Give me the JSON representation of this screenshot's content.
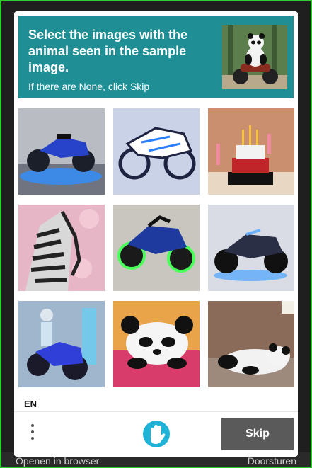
{
  "challenge": {
    "title": "Select the images with the animal seen in the sample image.",
    "subtitle": "If there are None, click Skip",
    "sample_image": "panda-riding-motorcycle"
  },
  "tiles": [
    {
      "content": "blue-motorcycle-showroom"
    },
    {
      "content": "wireframe-motorcycle"
    },
    {
      "content": "birthday-cake-candles"
    },
    {
      "content": "zebra-with-flowers"
    },
    {
      "content": "green-motorcycle"
    },
    {
      "content": "neon-motorcycle"
    },
    {
      "content": "robot-rider-motorcycle"
    },
    {
      "content": "panda-sleeping-cushion"
    },
    {
      "content": "panda-lying-floor"
    }
  ],
  "footer": {
    "language": "EN",
    "menu_icon": "more-vertical-icon",
    "logo_icon": "hand-logo-icon",
    "skip_label": "Skip"
  },
  "background": {
    "left_text": "Openen in browser",
    "right_text": "Doorsturen"
  },
  "colors": {
    "header": "#1f8f95",
    "skip_button": "#5a5a5a",
    "frame": "#2ecc2e"
  }
}
